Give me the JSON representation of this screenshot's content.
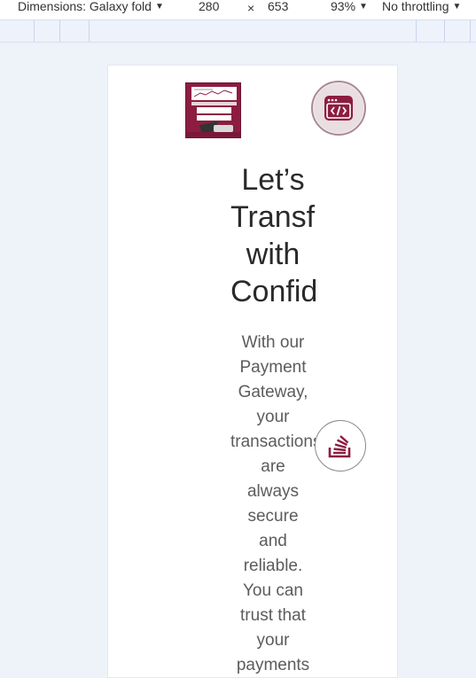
{
  "devtools": {
    "dimensions_label": "Dimensions: Galaxy fold",
    "width_value": "280",
    "times_symbol": "×",
    "height_value": "653",
    "zoom_label": "93%",
    "throttling_label": "No throttling",
    "dropdown_arrow": "▼"
  },
  "page": {
    "headline_lines": [
      "Let’s",
      "Transform",
      "with",
      "Confidence"
    ],
    "body_lines": [
      "With our",
      "Payment",
      "Gateway,",
      "your",
      "transactions",
      "are",
      "always",
      "secure",
      "and",
      "reliable.",
      "You can",
      "trust that",
      "your",
      "payments"
    ],
    "brand_color": "#8c1d40"
  },
  "icons": {
    "logo": "payment-gateway-logo",
    "top_right": "code-window-icon",
    "floating": "stack-overflow-icon"
  }
}
